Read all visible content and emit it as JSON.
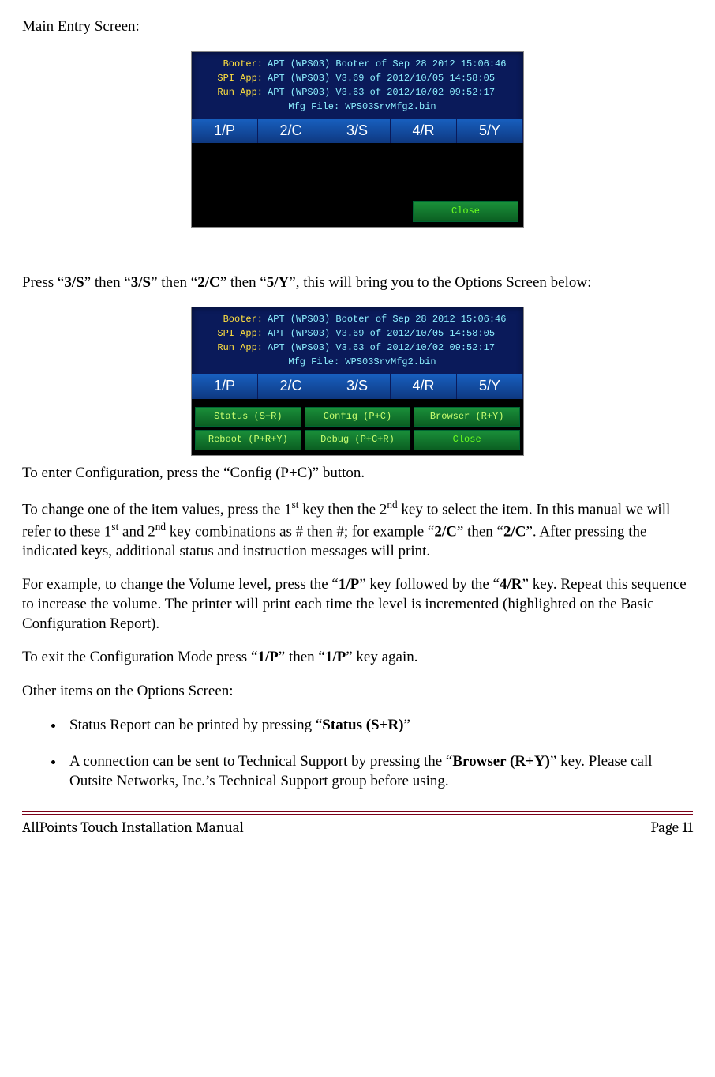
{
  "heading": "Main Entry Screen:",
  "screen_info": {
    "booter_label": "Booter:",
    "booter": "APT (WPS03) Booter of Sep 28 2012 15:06:46",
    "spi_label": "SPI App:",
    "spi": "APT (WPS03) V3.69 of 2012/10/05 14:58:05",
    "run_label": "Run App:",
    "run": "APT (WPS03) V3.63 of 2012/10/02 09:52:17",
    "mfg": "Mfg File: WPS03SrvMfg2.bin"
  },
  "keys": [
    "1/P",
    "2/C",
    "3/S",
    "4/R",
    "5/Y"
  ],
  "close": "Close",
  "option_buttons": [
    "Status (S+R)",
    "Config (P+C)",
    "Browser (R+Y)",
    "Reboot (P+R+Y)",
    "Debug (P+C+R)",
    "Close"
  ],
  "para_press": {
    "pre": "Press “",
    "k1": "3/S",
    "m1": "” then “",
    "k2": "3/S",
    "m2": "” then “",
    "k3": "2/C",
    "m3": "” then “",
    "k4": "5/Y",
    "post": "”, this will bring you to the Options Screen below:"
  },
  "para_config": "To enter Configuration, press the “Config (P+C)” button.",
  "para_change": {
    "a": "To change one of the item values, press the 1",
    "b": " key then the 2",
    "c": " key to select the item.  In this manual we will refer to these 1",
    "d": " and 2",
    "e": " key combinations as # then #; for example “",
    "k1": "2/C",
    "f": "” then “",
    "k2": "2/C",
    "g": "”.   After pressing the indicated keys, additional status and instruction messages will print."
  },
  "para_example": {
    "a": "For example, to change the Volume level, press the “",
    "k1": "1/P",
    "b": "” key followed by the “",
    "k2": "4/R",
    "c": "” key. Repeat this sequence to increase the volume. The printer will print each time the level is incremented (highlighted on the Basic Configuration Report)."
  },
  "para_exit": {
    "a": "To exit the Configuration Mode press “",
    "k1": "1/P",
    "b": "” then “",
    "k2": "1/P",
    "c": "” key again."
  },
  "para_other": "Other items on the Options Screen:",
  "bullet1": {
    "a": "Status Report can be printed by pressing “",
    "k": "Status (S+R)",
    "b": "”"
  },
  "bullet2": {
    "a": "A connection can be sent to Technical Support by pressing the “",
    "k": "Browser (R+Y)",
    "b": "” key. Please call Outsite Networks, Inc.’s Technical Support group before using."
  },
  "footer_left": "AllPoints Touch Installation Manual",
  "footer_right": "Page 11",
  "sup_st": "st",
  "sup_nd": "nd"
}
